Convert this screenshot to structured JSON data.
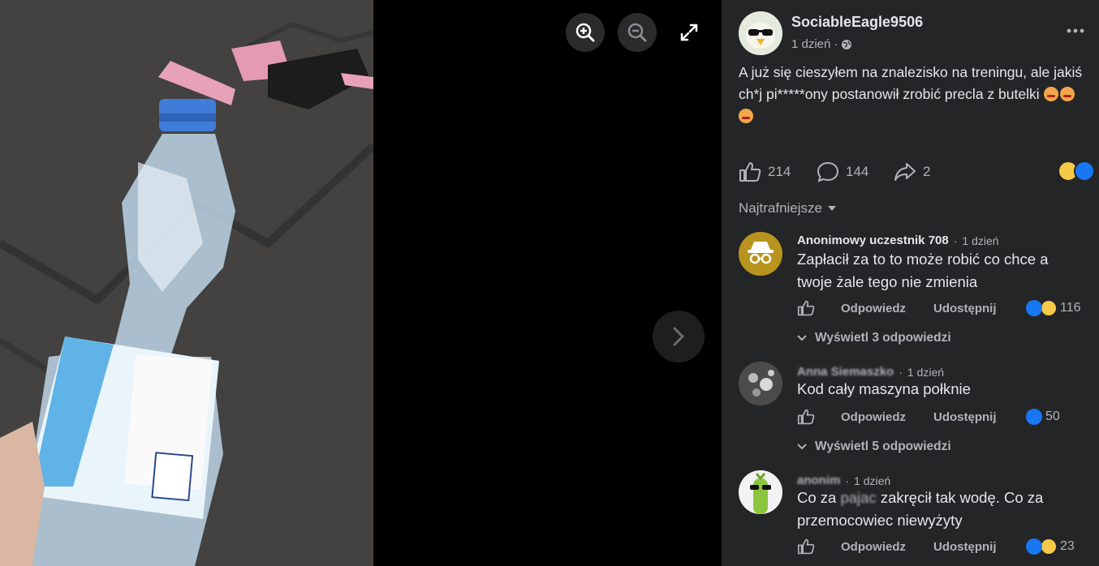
{
  "viewer": {
    "zoom_in_icon": "zoom-in-icon",
    "zoom_out_icon": "zoom-out-icon",
    "fullscreen_icon": "expand-icon",
    "next_icon": "chevron-right-icon"
  },
  "post": {
    "author": "SociableEagle9506",
    "time": "1 dzień",
    "text": "A już się cieszyłem na znalezisko na treningu, ale jakiś ch*j pi*****ony postanowił zrobić precla z butelki",
    "likes": "214",
    "comments": "144",
    "shares": "2"
  },
  "sort_label": "Najtrafniejsze",
  "comments": [
    {
      "author": "Anonimowy uczestnik 708",
      "time": "1 dzień",
      "text": "Zapłacił za to to może robić co chce a twoje żale tego nie zmienia",
      "reactions": "116",
      "replies": "Wyświetl 3 odpowiedzi"
    },
    {
      "author": "Anna Siemaszko",
      "time": "1 dzień",
      "text": "Kod cały maszyna połknie",
      "reactions": "50",
      "replies": "Wyświetl 5 odpowiedzi"
    },
    {
      "author": "anonim",
      "time": "1 dzień",
      "text_before": "Co za",
      "text_blurred": "pajac",
      "text_after": "zakręcił tak wodę. Co za przemocowiec niewyżyty",
      "reactions": "23"
    }
  ],
  "comment_actions": {
    "reply": "Odpowiedz",
    "share": "Udostępnij"
  },
  "colors": {
    "panel_bg": "#242526",
    "text_primary": "#e4e6eb",
    "text_secondary": "#b0b3b8",
    "like_blue": "#1877f2"
  }
}
